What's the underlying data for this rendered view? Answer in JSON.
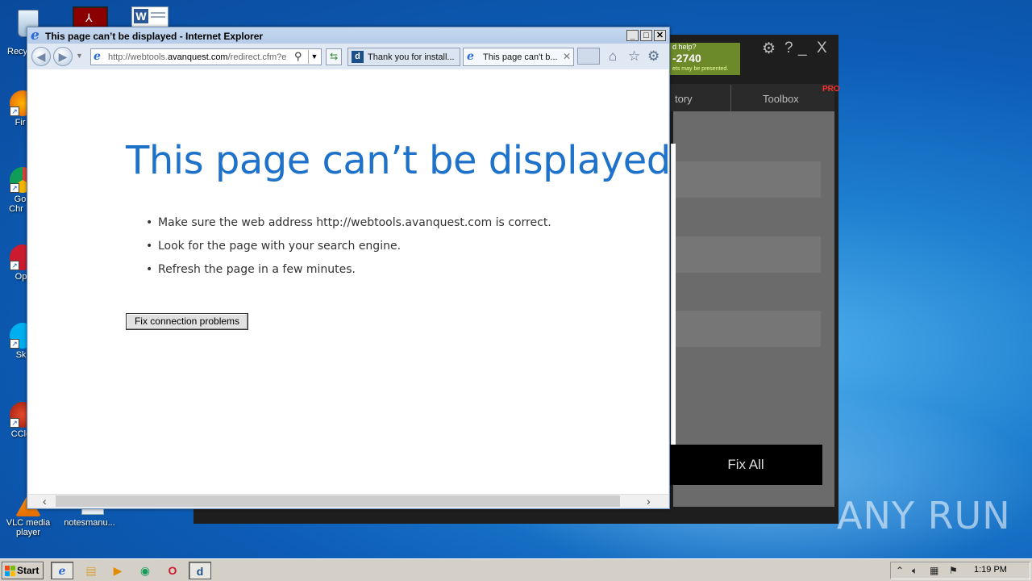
{
  "desktop": {
    "icons": [
      {
        "label": "Recy"
      },
      {
        "label": "Fir"
      },
      {
        "label": "Go\nChr"
      },
      {
        "label": "Op"
      },
      {
        "label": "Sk"
      },
      {
        "label": "CCle"
      },
      {
        "label": "VLC media\nplayer"
      },
      {
        "label": "notesmanu..."
      }
    ],
    "watermark": "ANY RUN"
  },
  "background_app": {
    "help_line1": "d help?",
    "help_number": "-2740",
    "help_line3": "ets may be presented.",
    "tab_history": "tory",
    "tab_toolbox": "Toolbox",
    "pro_badge": "PRO",
    "fix_all": "Fix All",
    "controls": {
      "settings": "⚙",
      "help": "?",
      "minimize": "_",
      "close": "X"
    }
  },
  "ie": {
    "title": "This page can’t be displayed - Internet Explorer",
    "address": {
      "prefix": "http://webtools.",
      "domain": "avanquest.com",
      "suffix": "/redirect.cfm?e"
    },
    "tabs": [
      {
        "label": "Thank you for install...",
        "active": false
      },
      {
        "label": "This page can't b...",
        "active": true
      }
    ],
    "content": {
      "heading": "This page can’t be displayed",
      "bullets": [
        "Make sure the web address http://webtools.avanquest.com is correct.",
        "Look for the page with your search engine.",
        "Refresh the page in a few minutes."
      ],
      "fix_button": "Fix connection problems"
    }
  },
  "taskbar": {
    "start_label": "Start",
    "clock": "1:19 PM"
  },
  "colors": {
    "heading": "#1f72c9",
    "desktop_bg": "#0d5cb5",
    "app_panel": "#6b6b6b",
    "pro_badge": "#ff2d2d"
  }
}
